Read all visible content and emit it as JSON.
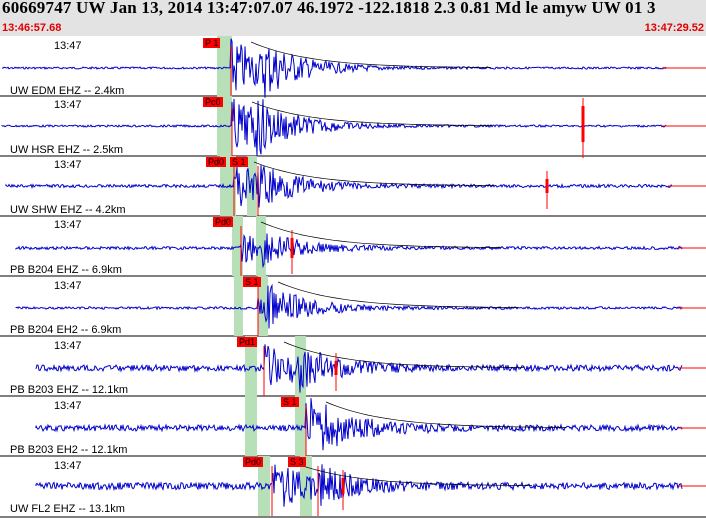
{
  "header": {
    "title": "60669747 UW Jan 13, 2014 13:47:07.07    46.1972 -122.1818  2.3 0.81 Md le amyw UW 01   3",
    "start_time": "13:46:57.68",
    "end_time": "13:47:29.52"
  },
  "colors": {
    "trace": "#0000cc",
    "pick": "#ff0000",
    "window": "#b8e0b8",
    "header_bg": "#e3e3e3",
    "coda": "#000000"
  },
  "panels": [
    {
      "time": "13:47",
      "label": "UW EDM EHZ -- 2.4km",
      "picks": [
        "P 1"
      ]
    },
    {
      "time": "13:47",
      "label": "UW HSR EHZ -- 2.5km",
      "picks": [
        "Pc0"
      ]
    },
    {
      "time": "13:47",
      "label": "UW SHW EHZ -- 4.2km",
      "picks": [
        "Pd0",
        "S 1"
      ]
    },
    {
      "time": "13:47",
      "label": "PB B204 EHZ -- 6.9km",
      "picks": [
        "Pd0"
      ]
    },
    {
      "time": "13:47",
      "label": "PB B204 EH2 -- 6.9km",
      "picks": [
        "S 1"
      ]
    },
    {
      "time": "13:47",
      "label": "PB B203 EHZ -- 12.1km",
      "picks": [
        "Pd1"
      ]
    },
    {
      "time": "13:47",
      "label": "PB B203 EH2 -- 12.1km",
      "picks": [
        "S 1"
      ]
    },
    {
      "time": "13:47",
      "label": "UW FL2 EHZ -- 13.1km",
      "picks": [
        "Pd0",
        "S 3"
      ]
    }
  ]
}
